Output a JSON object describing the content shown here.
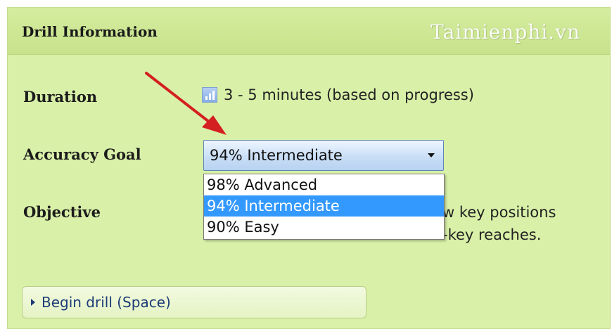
{
  "panel": {
    "title": "Drill Information",
    "watermark": "Taimienphi.vn"
  },
  "fields": {
    "duration_label": "Duration",
    "duration_value": "3 - 5 minutes (based on progress)",
    "accuracy_label": "Accuracy Goal",
    "objective_label": "Objective",
    "objective_line1_fragment": "w key positions",
    "objective_line2_fragment": "-key reaches."
  },
  "accuracy_select": {
    "selected": "94% Intermediate",
    "options": [
      "98% Advanced",
      "94% Intermediate",
      "90% Easy"
    ]
  },
  "begin_button": {
    "label": "Begin drill (Space)"
  },
  "icons": {
    "duration": "bar-chart-icon",
    "dropdown": "chevron-down-icon",
    "begin": "play-icon",
    "annotation": "red-arrow-annotation"
  },
  "colors": {
    "panel_bg": "#d9f0a8",
    "header_bg": "#c7e28b",
    "highlight": "#3399ff",
    "arrow": "#d42020",
    "button_text": "#1b3b77"
  }
}
